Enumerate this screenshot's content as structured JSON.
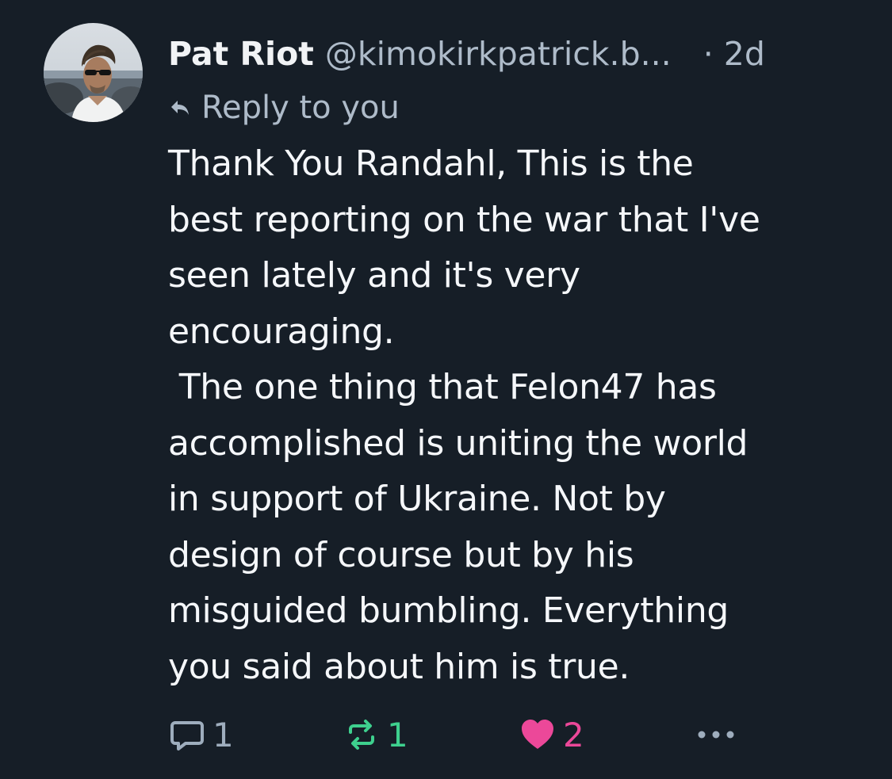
{
  "post": {
    "author_name": "Pat Riot",
    "author_handle": "@kimokirkpatrick.b...",
    "timestamp": "· 2d",
    "reply_label": "Reply to you",
    "text": "Thank You Randahl, This is the\nbest reporting on the war that I've\nseen lately and it's very\nencouraging.\n The one thing that Felon47 has\naccomplished is uniting the world\nin support of Ukraine. Not by\ndesign of course but by his\nmisguided bumbling. Everything\nyou said about him is true.",
    "avatar_icon": "profile-photo-avatar",
    "actions": {
      "reply_count": "1",
      "repost_count": "1",
      "like_count": "2"
    },
    "icons": {
      "reply_arrow": "reply-arrow-icon",
      "reply": "speech-bubble-icon",
      "repost": "repost-arrows-icon",
      "like": "heart-icon",
      "more": "ellipsis-icon"
    }
  },
  "colors": {
    "background": "#161e27",
    "primary_text": "#f5f7fa",
    "secondary_text": "#aebbc9",
    "repost_active": "#3ed08e",
    "like_active": "#ec4899"
  }
}
